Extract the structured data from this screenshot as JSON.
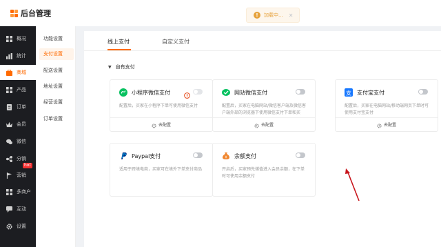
{
  "header": {
    "title": "后台管理",
    "toast": {
      "icon": "info-icon",
      "text": "加载中...",
      "close_icon": "close-icon"
    }
  },
  "sidebar": {
    "items": [
      {
        "label": "概况",
        "icon": "chart-icon"
      },
      {
        "label": "统计",
        "icon": "bar-chart-icon"
      },
      {
        "label": "商城",
        "icon": "shop-icon"
      },
      {
        "label": "产品",
        "icon": "grid-icon"
      },
      {
        "label": "订单",
        "icon": "order-icon"
      },
      {
        "label": "会员",
        "icon": "crown-icon"
      },
      {
        "label": "微信",
        "icon": "wechat-icon"
      },
      {
        "label": "分销",
        "icon": "share-icon"
      },
      {
        "label": "营销",
        "icon": "flag-icon"
      },
      {
        "label": "多商户",
        "icon": "store-icon"
      },
      {
        "label": "互动",
        "icon": "chat-icon"
      },
      {
        "label": "设置",
        "icon": "gear-icon"
      }
    ],
    "hot_badge": "hot"
  },
  "submenu": {
    "items": [
      {
        "label": "功能设置"
      },
      {
        "label": "支付设置"
      },
      {
        "label": "配送设置"
      },
      {
        "label": "地址设置"
      },
      {
        "label": "经营设置"
      },
      {
        "label": "订单设置"
      }
    ]
  },
  "tabs": [
    {
      "label": "线上支付"
    },
    {
      "label": "自定义支付"
    }
  ],
  "section": {
    "title": "自有支付"
  },
  "cards": [
    {
      "title": "小程序微信支付",
      "icon": "miniprogram-icon",
      "desc": "配置后，买家在小程序下单可使用微信支付",
      "footer": "去配置"
    },
    {
      "title": "网站微信支付",
      "icon": "wechat-pay-icon",
      "desc": "配置后，买家在电脑网站/微信客户端及微信客户端外部的浏览器下使用微信支付下单和买",
      "footer": "去配置"
    },
    {
      "title": "支付宝支付",
      "icon": "alipay-icon",
      "desc": "配置后，买家在电脑网站/移动端网页下单时可使用支付宝支付",
      "footer": "去配置"
    },
    {
      "title": "Paypal支付",
      "icon": "paypal-icon",
      "desc": "适用于跨境电商，买家可在境外下单支付商品",
      "footer": "去配置"
    },
    {
      "title": "余额支付",
      "icon": "balance-icon",
      "desc": "开启后，买家预先储值进入会员余额，在下单时可使用余额支付",
      "footer": "去配置"
    }
  ],
  "colors": {
    "accent": "#ff6a00",
    "sidebar_bg": "#1c1d21",
    "wechat_green": "#07c160",
    "alipay_blue": "#1677ff",
    "arrow_red": "#c8161d"
  }
}
